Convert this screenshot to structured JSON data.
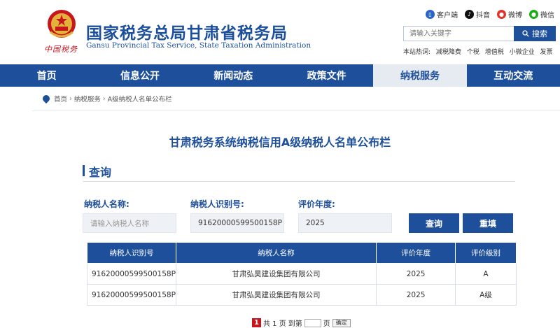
{
  "header": {
    "title": "国家税务总局甘肃省税务局",
    "subtitle": "Gansu Provincial Tax Service, State Taxation Administration",
    "calligraphy": "中国税务",
    "social": [
      {
        "label": "客户端",
        "icon": "mobile-icon",
        "color": "#2a64c5"
      },
      {
        "label": "抖音",
        "icon": "douyin-icon",
        "color": "#111111"
      },
      {
        "label": "微博",
        "icon": "weibo-icon",
        "color": "#e2332b"
      },
      {
        "label": "微信",
        "icon": "wechat-icon",
        "color": "#1aad19"
      }
    ],
    "search": {
      "placeholder": "请输入关键字",
      "button": "搜索"
    },
    "hot_label": "本站热词:",
    "hot_words": [
      "减税降费",
      "个税",
      "增值税",
      "小微企业",
      "发票"
    ]
  },
  "nav": {
    "items": [
      "首页",
      "信息公开",
      "新闻动态",
      "政策文件",
      "纳税服务",
      "互动交流"
    ],
    "active_index": 4
  },
  "breadcrumb": [
    "首页",
    "纳税服务",
    "A级纳税人名单公布栏"
  ],
  "main": {
    "title": "甘肃税务系统纳税信用A级纳税人名单公布栏",
    "section": "查询",
    "fields": {
      "name_label": "纳税人名称:",
      "name_placeholder": "请输入纳税人名称",
      "id_label": "纳税人识别号:",
      "id_value": "91620000599500158P",
      "year_label": "评价年度:",
      "year_value": "2025"
    },
    "buttons": {
      "query": "查询",
      "reset": "重填"
    },
    "table": {
      "columns": [
        "纳税人识别号",
        "纳税人名称",
        "评价年度",
        "评价级别"
      ],
      "rows": [
        [
          "91620000599500158P",
          "甘肃弘昊建设集团有限公司",
          "2025",
          "A"
        ],
        [
          "91620000599500158P",
          "甘肃弘昊建设集团有限公司",
          "2025",
          "A级"
        ]
      ]
    },
    "pager": {
      "current": "1",
      "text_total": "共 1 页",
      "text_goto": "到第",
      "text_page": "页",
      "go": "确定"
    }
  },
  "colors": {
    "primary": "#1d4f9b",
    "accent": "#c8161d"
  }
}
